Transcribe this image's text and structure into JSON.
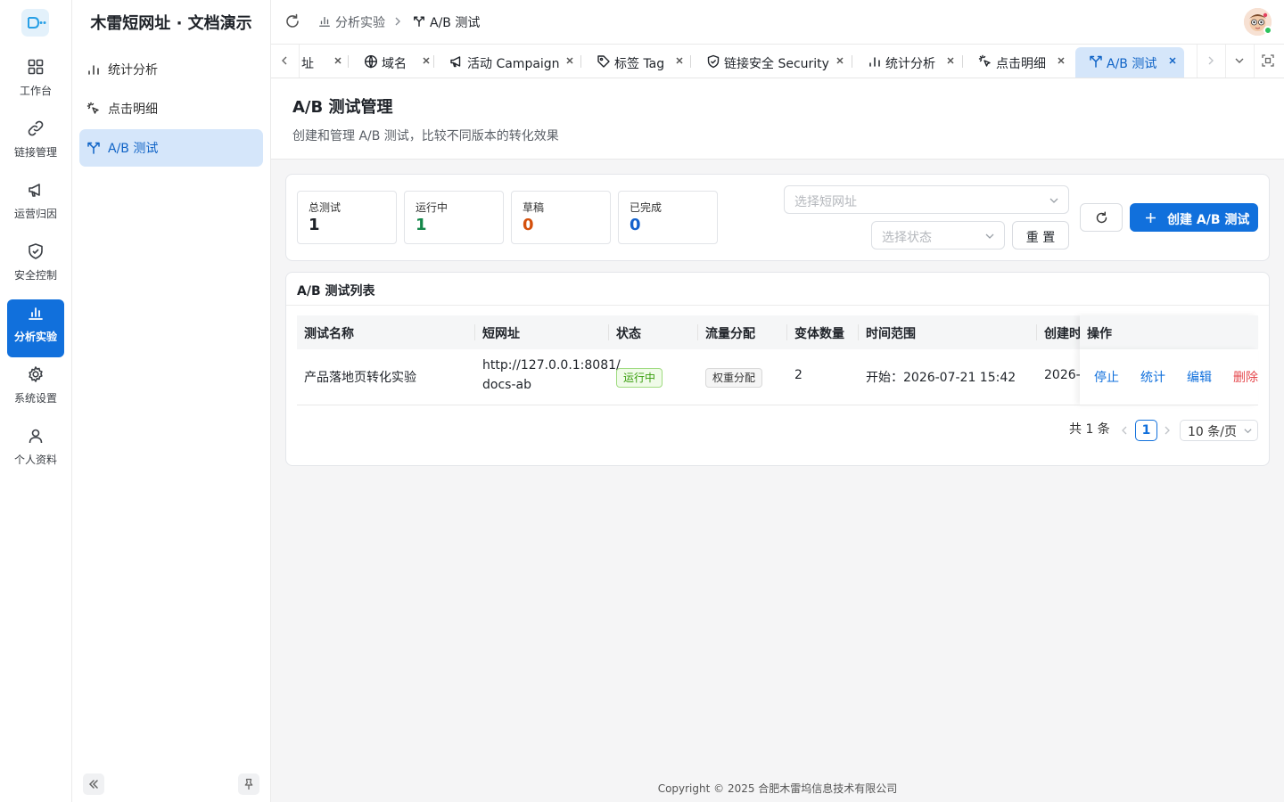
{
  "app": {
    "site_title": "木雷短网址 · 文档演示"
  },
  "rail": {
    "items": [
      {
        "label": "工作台",
        "icon": "dashboard-icon"
      },
      {
        "label": "链接管理",
        "icon": "link-icon"
      },
      {
        "label": "运营归因",
        "icon": "megaphone-icon"
      },
      {
        "label": "安全控制",
        "icon": "shield-icon"
      },
      {
        "label": "分析实验",
        "icon": "bar-chart-icon",
        "active": true
      },
      {
        "label": "系统设置",
        "icon": "gear-icon"
      },
      {
        "label": "个人资料",
        "icon": "user-icon"
      }
    ]
  },
  "submenu": {
    "items": [
      {
        "label": "统计分析",
        "icon": "bar-chart-icon"
      },
      {
        "label": "点击明细",
        "icon": "click-icon"
      },
      {
        "label": "A/B 测试",
        "icon": "split-icon",
        "active": true
      }
    ]
  },
  "header": {
    "breadcrumb": [
      {
        "label": "分析实验",
        "icon": "bar-chart-icon"
      },
      {
        "label": "A/B 测试",
        "icon": "split-icon"
      }
    ]
  },
  "tabs": [
    {
      "label": "网址",
      "visible_label": "址",
      "icon": "link-icon"
    },
    {
      "label": "域名",
      "icon": "globe-icon"
    },
    {
      "label": "活动 Campaign",
      "icon": "megaphone-icon"
    },
    {
      "label": "标签 Tag",
      "icon": "tag-icon"
    },
    {
      "label": "链接安全 Security",
      "icon": "shield-icon"
    },
    {
      "label": "统计分析",
      "icon": "bar-chart-icon"
    },
    {
      "label": "点击明细",
      "icon": "click-icon"
    },
    {
      "label": "A/B 测试",
      "icon": "split-icon",
      "active": true
    }
  ],
  "page": {
    "title": "A/B 测试管理",
    "description": "创建和管理 A/B 测试，比较不同版本的转化效果"
  },
  "stats": [
    {
      "label": "总测试",
      "value": "1",
      "color": "#1f2329"
    },
    {
      "label": "运行中",
      "value": "1",
      "color": "#15874a"
    },
    {
      "label": "草稿",
      "value": "0",
      "color": "#d4500c"
    },
    {
      "label": "已完成",
      "value": "0",
      "color": "#1462cc"
    }
  ],
  "filters": {
    "short_url_placeholder": "选择短网址",
    "status_placeholder": "选择状态",
    "reset_label": "重 置",
    "create_label": "创建 A/B 测试"
  },
  "table": {
    "title": "A/B 测试列表",
    "columns": [
      "测试名称",
      "短网址",
      "状态",
      "流量分配",
      "变体数量",
      "时间范围",
      "创建时间",
      "操作"
    ],
    "visible_created_header": "创建时",
    "rows": [
      {
        "name": "产品落地页转化实验",
        "short_url_line1": "http://127.0.0.1:8081/",
        "short_url_line2": "docs-ab",
        "status": "运行中",
        "traffic": "权重分配",
        "variants": "2",
        "time_range": "开始：2026-07-21 15:42",
        "created": "2026-",
        "actions": [
          "停止",
          "统计",
          "编辑",
          "删除"
        ]
      }
    ]
  },
  "pagination": {
    "total": "共 1 条",
    "current": "1",
    "page_size": "10 条/页"
  },
  "footer": {
    "copyright": "Copyright © 2025 合肥木雷坞信息技术有限公司"
  },
  "colors": {
    "primary": "#1170dc",
    "success": "#15874a",
    "danger": "#e5484d",
    "active_bg": "#d5e6fa"
  }
}
